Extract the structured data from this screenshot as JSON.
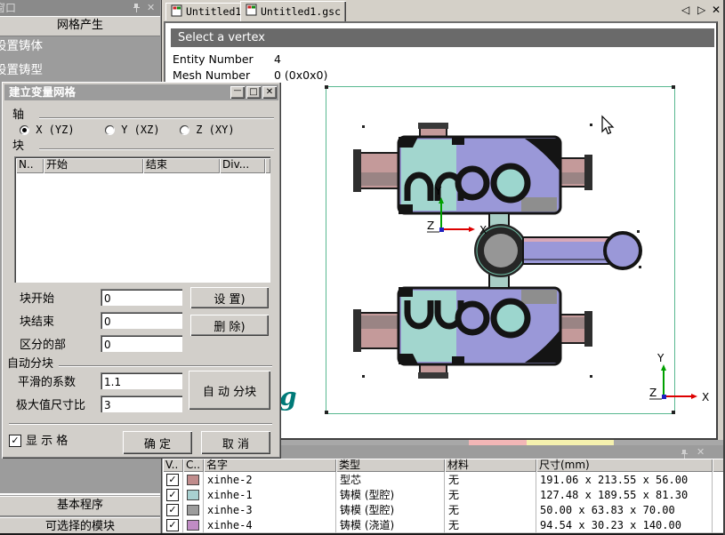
{
  "icons": {
    "check": "✓",
    "close": "✕",
    "minimize": "—",
    "maximize": "□",
    "tab_prev": "◁",
    "tab_next": "▷"
  },
  "sidebar": {
    "title": "窗口",
    "header": "网格产生",
    "items": [
      {
        "label": "设置铸体"
      },
      {
        "label": "设置铸型"
      }
    ],
    "bottom_bars": [
      {
        "label": "基本程序"
      },
      {
        "label": "可选择的模块"
      }
    ]
  },
  "dialog": {
    "title": "建立变量网格",
    "axis": {
      "group_label": "轴",
      "options": [
        {
          "label": "X (YZ)"
        },
        {
          "label": "Y (XZ)"
        },
        {
          "label": "Z (XY)"
        }
      ]
    },
    "block": {
      "group_label": "块",
      "columns": [
        "N..",
        "开始",
        "结束",
        "Div..."
      ]
    },
    "block_start_label": "块开始",
    "block_start_value": "0",
    "block_end_label": "块结束",
    "block_end_value": "0",
    "divisions_label": "区分的部",
    "divisions_value": "0",
    "set_button": "设 置)",
    "delete_button": "删 除)",
    "auto_group_label": "自动分块",
    "smooth_label": "平滑的系数",
    "smooth_value": "1.1",
    "ratio_label": "极大值尺寸比",
    "ratio_value": "3",
    "auto_button": "自 动 分块",
    "show_grid_label": "显 示 格",
    "ok_button": "确 定",
    "cancel_button": "取 消"
  },
  "main": {
    "tabs": [
      {
        "label": "Untitled1"
      },
      {
        "label": "Untitled1.gsc"
      }
    ],
    "viewport": {
      "banner": "Select a vertex",
      "entity_label": "Entity Number",
      "entity_value": "4",
      "mesh_label": "Mesh Number",
      "mesh_value": "0 (0x0x0)",
      "watermark": "g",
      "axis": {
        "x": "X",
        "y": "Y",
        "z": "Z"
      }
    }
  },
  "bottom_panel": {
    "columns": [
      "V..",
      "C..",
      "名字",
      "类型",
      "材料",
      "尺寸(mm)"
    ],
    "rows": [
      {
        "name": "xinhe-2",
        "type": "型芯",
        "material": "无",
        "size": "191.06 x 213.55 x 56.00",
        "color": "#c08c8c"
      },
      {
        "name": "xinhe-1",
        "type": "铸模 (型腔)",
        "material": "无",
        "size": "127.48 x 189.55 x 81.30",
        "color": "#a8d0d0"
      },
      {
        "name": "xinhe-3",
        "type": "铸模 (型腔)",
        "material": "无",
        "size": "50.00 x 63.83 x 70.00",
        "color": "#9c9c9c"
      },
      {
        "name": "xinhe-4",
        "type": "铸模 (浇道)",
        "material": "无",
        "size": "94.54 x 30.23 x 140.00",
        "color": "#c08cc4"
      }
    ]
  },
  "colors": {
    "selection_box": "#58b890",
    "banner_bg": "#6a6a6a",
    "model_purple": "#9a98d8",
    "model_teal": "#9cd6ce",
    "model_pink": "#c49a9a",
    "model_gray": "#969696",
    "watermark": "#007a78"
  }
}
